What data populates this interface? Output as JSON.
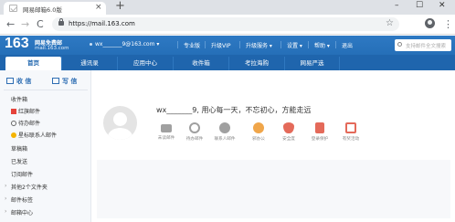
{
  "browser": {
    "tab_title": "网易邮箱6.0版",
    "tab_close": "×",
    "new_tab": "+",
    "url": "https://mail.163.com",
    "nav": {
      "back": "←",
      "forward": "→",
      "reload": "C"
    },
    "star": "☆",
    "menu": "⋮",
    "window": {
      "minimize": "–",
      "maximize": "☐",
      "close": "✕"
    }
  },
  "mail_header": {
    "logo_number": "163",
    "logo_title": "网易免费邮",
    "logo_domain": "mail.163.com",
    "user": "wx_______9@163.com ▾",
    "links": [
      "专业版",
      "升级VIP",
      "升级服务 ▾",
      "设置 ▾",
      "帮助 ▾",
      "退出"
    ],
    "search_placeholder": "支持邮件全文搜索"
  },
  "module_tabs": [
    "首页",
    "通讯录",
    "应用中心",
    "收件箱",
    "考拉海购",
    "网易严选"
  ],
  "sidebar": {
    "receive_label": "收 信",
    "compose_label": "写 信",
    "items": [
      "收件箱",
      "红旗邮件",
      "待办邮件",
      "星标联系人邮件",
      "草稿箱",
      "已发送",
      "订阅邮件"
    ],
    "groups": [
      "其他2个文件夹",
      "邮件标签",
      "邮箱中心"
    ]
  },
  "main": {
    "greeting": "wx_______9,  用心每一天，不忘初心，方能走远",
    "quick_items": [
      {
        "label": "未读邮件",
        "icon": "envelope-icon",
        "color": "#a0a0a0"
      },
      {
        "label": "待办邮件",
        "icon": "clock-icon",
        "color": "#a0a0a0"
      },
      {
        "label": "联系人邮件",
        "icon": "contact-icon",
        "color": "#a0a0a0"
      },
      {
        "label": "邪办公",
        "icon": "office-icon",
        "color": "#f0a64a"
      },
      {
        "label": "安全度",
        "icon": "shield-icon",
        "color": "#e46a5a"
      },
      {
        "label": "登录保护",
        "icon": "lock-icon",
        "color": "#e46a5a"
      },
      {
        "label": "有奖活动",
        "icon": "calendar-icon",
        "color": "#e46a5a"
      }
    ]
  },
  "colors": {
    "brand_blue": "#2e79c3",
    "tab_blue": "#1f65ad",
    "red_flag": "#e5433b",
    "star": "#f5b400"
  }
}
